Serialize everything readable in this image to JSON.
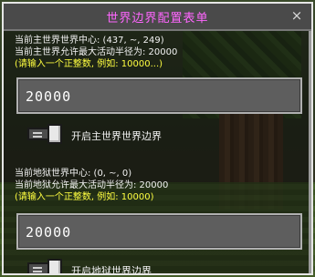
{
  "dialog": {
    "title": "世界边界配置表单",
    "close_glyph": "×"
  },
  "overworld": {
    "center_line": "当前主世界世界中心: (437, ~, 249)",
    "radius_line": "当前主世界允许最大活动半径为: 20000",
    "prompt_line": "(请输入一个正整数, 例如: 10000...)",
    "input_value": "20000",
    "toggle_label": "开启主世界世界边界",
    "toggle_state": "off"
  },
  "nether": {
    "center_line": "当前地狱世界中心: (0, ~, 0)",
    "radius_line": "当前地狱允许最大活动半径为: 20000",
    "prompt_line": "(请输入一个正整数, 例如: 10000)",
    "input_value": "20000",
    "toggle_label": "开启地狱世界边界",
    "toggle_state": "off"
  },
  "colors": {
    "title": "#ff66ff",
    "prompt": "#ffff40",
    "text": "#f2f2f2"
  }
}
